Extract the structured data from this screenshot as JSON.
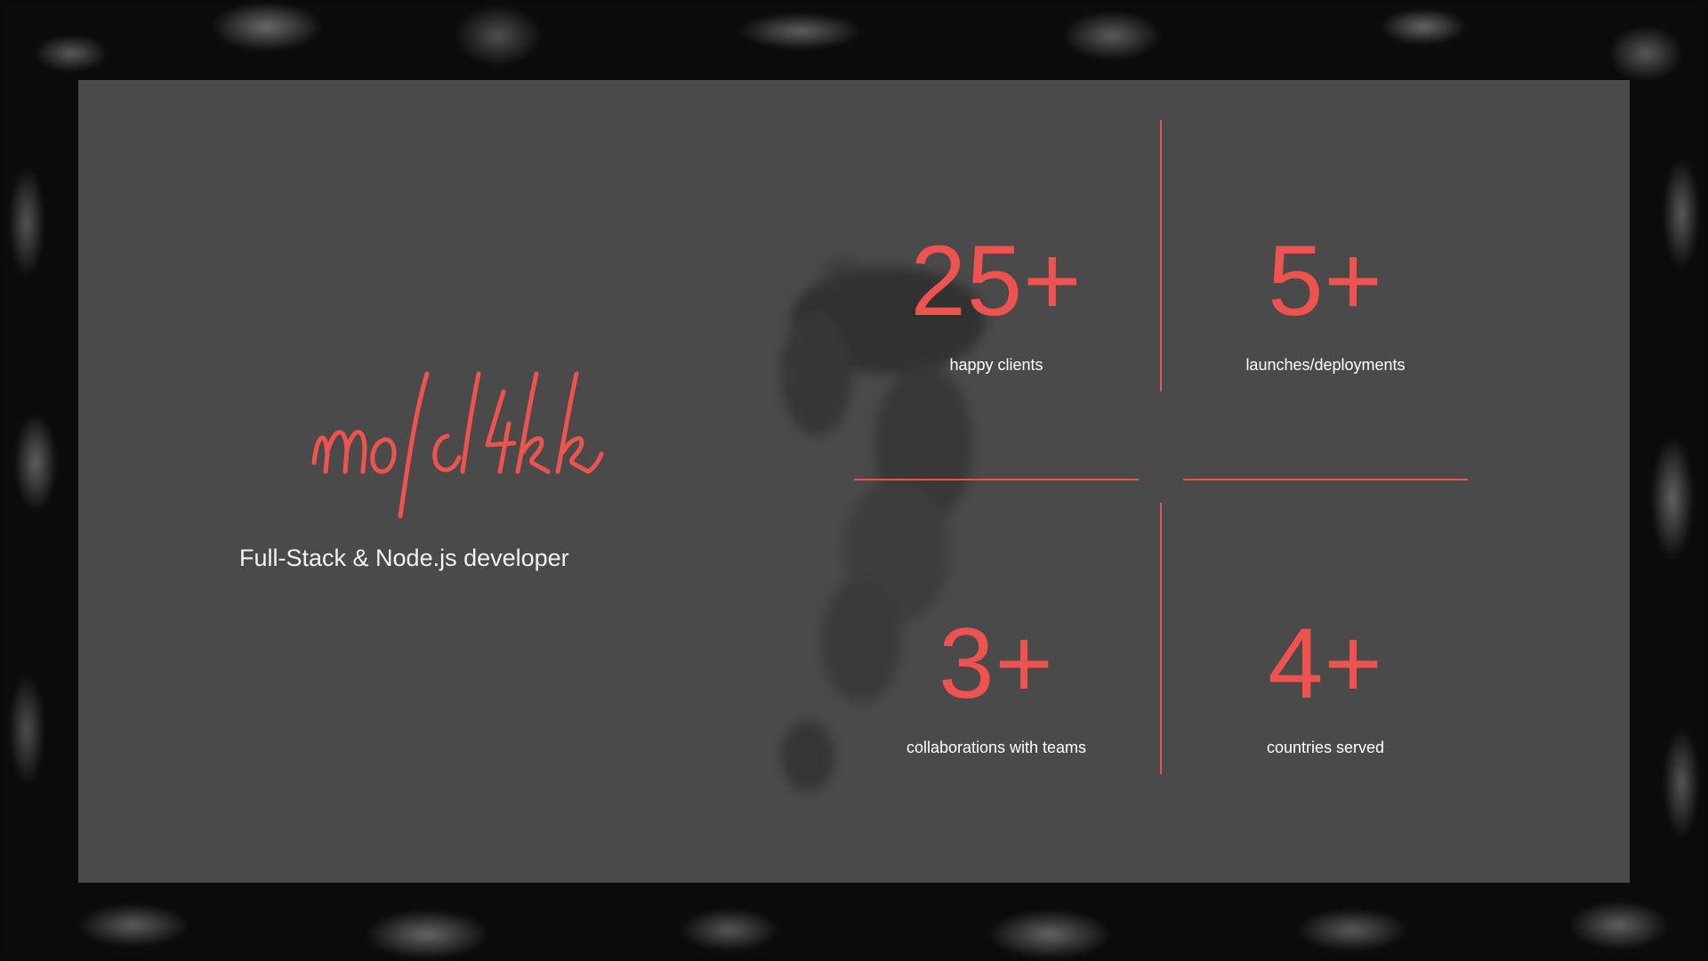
{
  "brand": {
    "signature": "m0lc14kk",
    "tagline": "Full-Stack & Node.js developer",
    "accent_color": "#ef5350"
  },
  "stats": [
    {
      "value": "25+",
      "label": "happy clients"
    },
    {
      "value": "5+",
      "label": "launches/deployments"
    },
    {
      "value": "3+",
      "label": "collaborations with teams"
    },
    {
      "value": "4+",
      "label": "countries served"
    }
  ]
}
